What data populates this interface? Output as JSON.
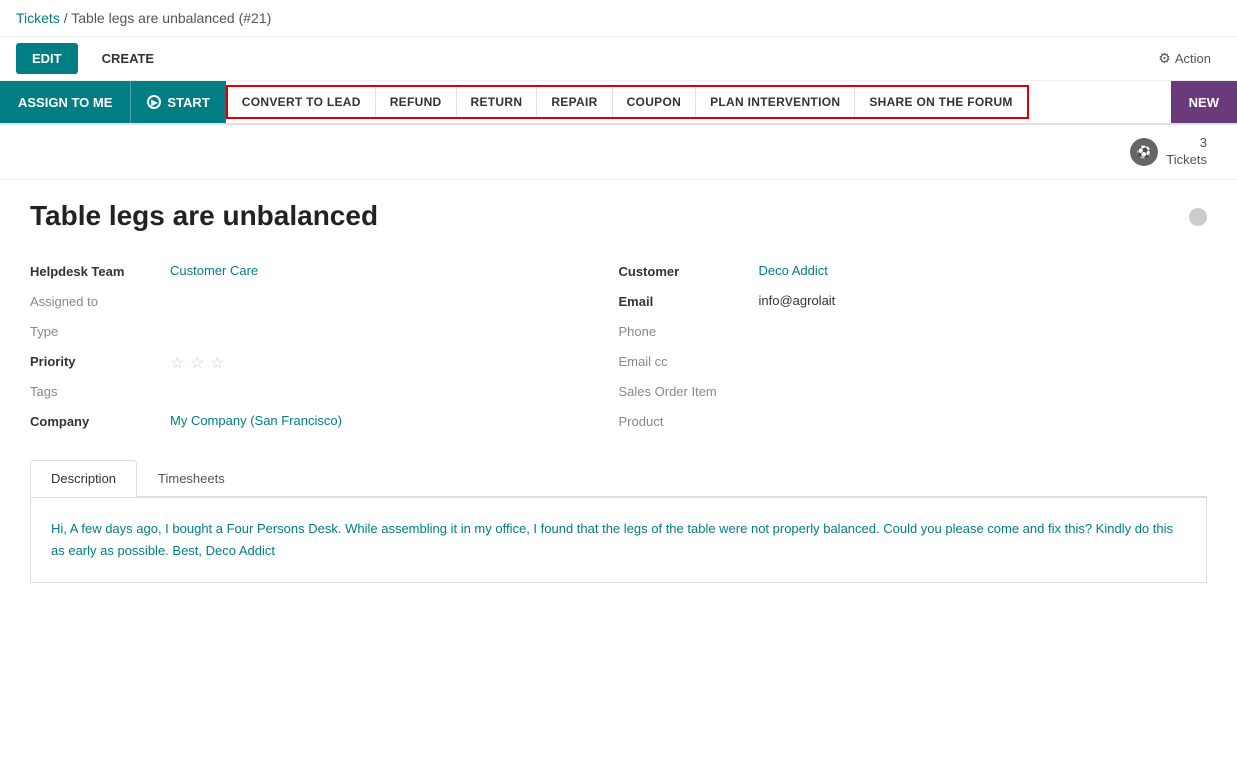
{
  "breadcrumb": {
    "parent": "Tickets",
    "separator": "/",
    "current": "Table legs are unbalanced (#21)"
  },
  "toolbar": {
    "edit_label": "EDIT",
    "create_label": "CREATE",
    "action_label": "Action"
  },
  "action_bar": {
    "assign_label": "ASSIGN TO ME",
    "start_label": "START",
    "action_buttons": [
      "CONVERT TO LEAD",
      "REFUND",
      "RETURN",
      "REPAIR",
      "COUPON",
      "PLAN INTERVENTION",
      "SHARE ON THE FORUM"
    ],
    "new_label": "NEW"
  },
  "ticket_count": {
    "count": "3",
    "label": "Tickets"
  },
  "form": {
    "title": "Table legs are unbalanced",
    "left": {
      "helpdesk_team_label": "Helpdesk Team",
      "helpdesk_team_value": "Customer Care",
      "assigned_to_label": "Assigned to",
      "assigned_to_value": "",
      "type_label": "Type",
      "type_value": "",
      "priority_label": "Priority",
      "tags_label": "Tags",
      "tags_value": "",
      "company_label": "Company",
      "company_value": "My Company (San Francisco)"
    },
    "right": {
      "customer_label": "Customer",
      "customer_value": "Deco Addict",
      "email_label": "Email",
      "email_value": "info@agrolait",
      "phone_label": "Phone",
      "phone_value": "",
      "email_cc_label": "Email cc",
      "email_cc_value": "",
      "sales_order_label": "Sales Order Item",
      "sales_order_value": "",
      "product_label": "Product",
      "product_value": ""
    }
  },
  "tabs": {
    "items": [
      "Description",
      "Timesheets"
    ]
  },
  "description": {
    "text": "Hi, A few days ago, I bought a Four Persons Desk. While assembling it in my office, I found that the legs of the table were not properly balanced. Could you please come and fix this? Kindly do this as early as possible. Best, Deco Addict"
  },
  "colors": {
    "teal": "#017e84",
    "red_border": "#cc0000",
    "purple": "#6b3a7d"
  }
}
